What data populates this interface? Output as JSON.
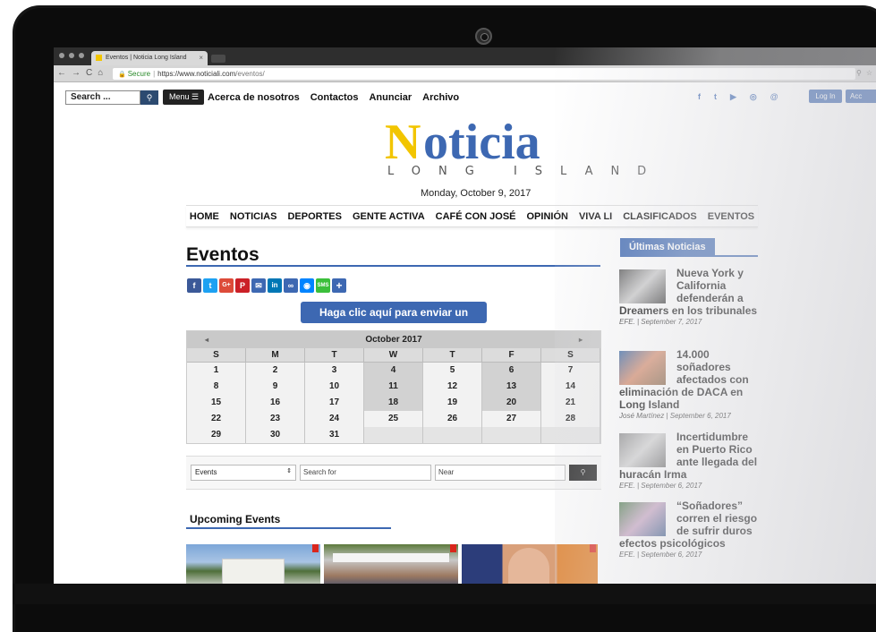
{
  "browser": {
    "tab_title": "Eventos | Noticia Long Island",
    "secure_label": "Secure",
    "url_base": "https://www.noticiali.com",
    "url_path": "/eventos/"
  },
  "topbar": {
    "search_placeholder": "Search ...",
    "menu_label": "Menu ☰",
    "links": [
      "Acerca de nosotros",
      "Contactos",
      "Anunciar",
      "Archivo"
    ],
    "login_label": "Log In",
    "account_label": "Acc"
  },
  "logo": {
    "main": "Noticia",
    "sub": "LONG ISLAND"
  },
  "date": "Monday, October 9, 2017",
  "main_nav": [
    "HOME",
    "NOTICIAS",
    "DEPORTES",
    "GENTE ACTIVA",
    "CAFÉ CON JOSÉ",
    "OPINIÓN",
    "VIVA LI",
    "CLASIFICADOS",
    "EVENTOS"
  ],
  "page_title": "Eventos",
  "submit_event_label": "Haga clic aquí para enviar un evento",
  "calendar": {
    "month_label": "October 2017",
    "weekdays": [
      "S",
      "M",
      "T",
      "W",
      "T",
      "F",
      "S"
    ],
    "weeks": [
      [
        "1",
        "2",
        "3",
        "4",
        "5",
        "6",
        "7"
      ],
      [
        "8",
        "9",
        "10",
        "11",
        "12",
        "13",
        "14"
      ],
      [
        "15",
        "16",
        "17",
        "18",
        "19",
        "20",
        "21"
      ],
      [
        "22",
        "23",
        "24",
        "25",
        "26",
        "27",
        "28"
      ],
      [
        "29",
        "30",
        "31",
        "",
        "",
        "",
        ""
      ]
    ]
  },
  "filter": {
    "type_value": "Events",
    "search_placeholder": "Search for",
    "near_placeholder": "Near"
  },
  "upcoming_title": "Upcoming Events",
  "sidebar": {
    "title": "Últimas Noticias",
    "items": [
      {
        "title": "Nueva York y California defenderán a Dreamers en los tribunales",
        "meta": "EFE. | September 7, 2017"
      },
      {
        "title": "14.000 soñadores afectados con eliminación de DACA en Long Island",
        "meta": "José Martínez | September 6, 2017"
      },
      {
        "title": "Incertidumbre en Puerto Rico ante llegada del huracán Irma",
        "meta": "EFE. | September 6, 2017"
      },
      {
        "title": "“Soñadores” corren el riesgo de sufrir duros efectos psicológicos",
        "meta": "EFE. | September 6, 2017"
      }
    ]
  },
  "colors": {
    "brand_blue": "#3d68b2",
    "logo_yellow": "#f2c500"
  }
}
